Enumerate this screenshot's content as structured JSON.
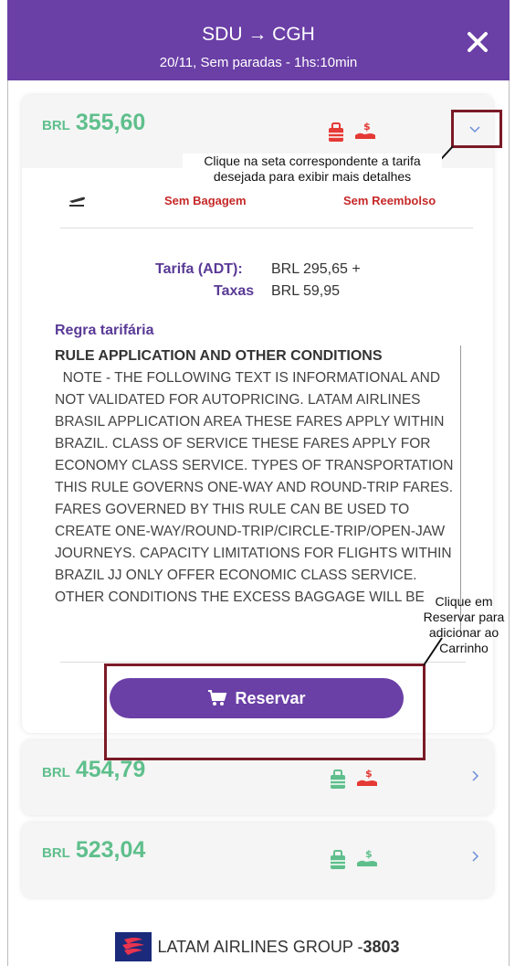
{
  "header": {
    "route": "SDU → CGH",
    "subtitle": "20/11, Sem paradas - 1hs:10min"
  },
  "fares": [
    {
      "currency": "BRL",
      "price": "355,60",
      "expanded": true,
      "bag_color": "#e53935",
      "refund_color": "#e53935"
    },
    {
      "currency": "BRL",
      "price": "454,79",
      "expanded": false,
      "bag_color": "#5fbf8c",
      "refund_color": "#e53935"
    },
    {
      "currency": "BRL",
      "price": "523,04",
      "expanded": false,
      "bag_color": "#5fbf8c",
      "refund_color": "#5fbf8c"
    }
  ],
  "details": {
    "baggage": "Sem Bagagem",
    "refund": "Sem Reembolso",
    "tarifa_label": "Tarifa (ADT):",
    "tarifa_value": "BRL 295,65 +",
    "taxas_label": "Taxas",
    "taxas_value": "BRL 59,95",
    "rule_title": "Regra tarifária",
    "rule_heading": "RULE APPLICATION AND OTHER CONDITIONS",
    "rule_body": "  NOTE - THE FOLLOWING TEXT IS INFORMATIONAL AND NOT VALIDATED FOR AUTOPRICING. LATAM AIRLINES BRASIL APPLICATION AREA THESE FARES APPLY WITHIN BRAZIL. CLASS OF SERVICE THESE FARES APPLY FOR ECONOMY CLASS SERVICE. TYPES OF TRANSPORTATION THIS RULE GOVERNS ONE-WAY AND ROUND-TRIP FARES. FARES GOVERNED BY THIS RULE CAN BE USED TO CREATE ONE-WAY/ROUND-TRIP/CIRCLE-TRIP/OPEN-JAW JOURNEYS. CAPACITY LIMITATIONS FOR FLIGHTS WITHIN BRAZIL JJ ONLY OFFER ECONOMIC CLASS SERVICE. OTHER CONDITIONS THE EXCESS BAGGAGE WILL BE",
    "reserve_label": "Reservar"
  },
  "annotations": {
    "arrow_hint": "Clique na seta correspondente a tarifa desejada para exibir mais detalhes",
    "reserve_hint": "Clique em Reservar para adicionar ao Carrinho"
  },
  "footer": {
    "company": "LATAM AIRLINES GROUP - ",
    "number": "3803"
  },
  "colors": {
    "primary": "#6a3fa6",
    "price": "#5fbf8c",
    "alert": "#e53935",
    "annotation_box": "#7a1a26"
  }
}
